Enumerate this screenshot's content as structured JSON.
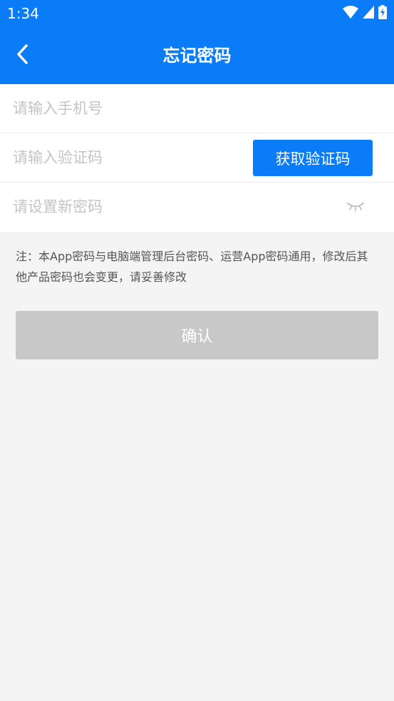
{
  "status_bar": {
    "time": "1:34",
    "icons": [
      "wifi-icon",
      "cell-signal-icon",
      "battery-charging-icon"
    ]
  },
  "header": {
    "title": "忘记密码",
    "back_icon": "chevron-left-icon"
  },
  "form": {
    "phone": {
      "value": "",
      "placeholder": "请输入手机号"
    },
    "code": {
      "value": "",
      "placeholder": "请输入验证码",
      "button_label": "获取验证码"
    },
    "password": {
      "value": "",
      "placeholder": "请设置新密码",
      "toggle_icon": "eye-closed-icon"
    }
  },
  "note": "注：本App密码与电脑端管理后台密码、运营App密码通用，修改后其他产品密码也会变更，请妥善修改",
  "confirm": {
    "label": "确认",
    "enabled": false
  },
  "colors": {
    "primary": "#0a7cf8",
    "background": "#f4f4f4",
    "disabled_button": "#c8c8c8",
    "placeholder": "#c4c4c4",
    "note_text": "#555555"
  }
}
